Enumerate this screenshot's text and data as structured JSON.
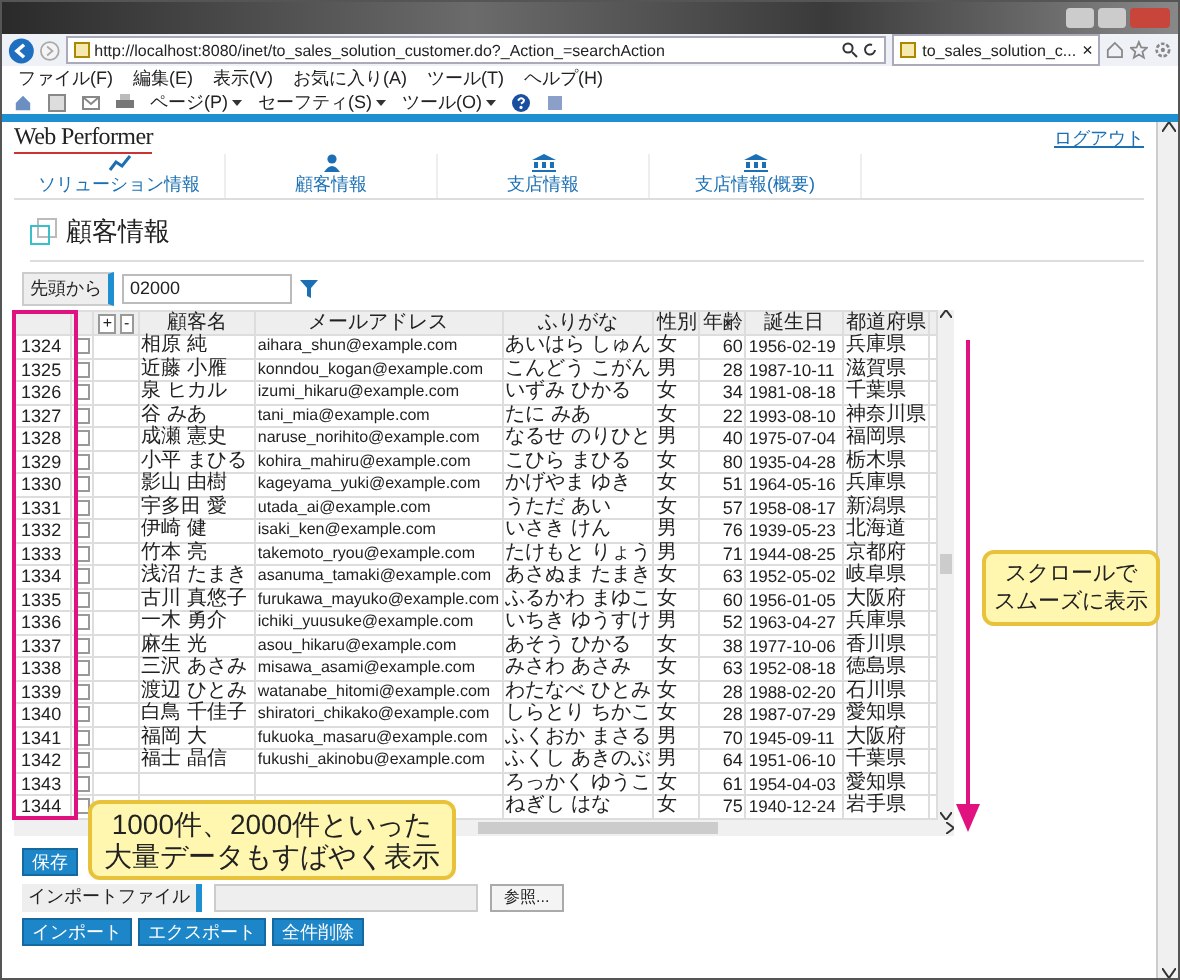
{
  "browser": {
    "address": "http://localhost:8080/inet/to_sales_solution_customer.do?_Action_=searchAction",
    "tab": {
      "title": "to_sales_solution_c...",
      "close": "×"
    },
    "menu": [
      "ファイル(F)",
      "編集(E)",
      "表示(V)",
      "お気に入り(A)",
      "ツール(T)",
      "ヘルプ(H)"
    ],
    "toolbar": [
      "ページ(P)",
      "セーフティ(S)",
      "ツール(O)"
    ]
  },
  "app": {
    "logo": "Web Performer",
    "logout": "ログアウト",
    "nav": [
      {
        "label": "ソリューション情報",
        "kind": "chart"
      },
      {
        "label": "顧客情報",
        "kind": "person"
      },
      {
        "label": "支店情報",
        "kind": "bank"
      },
      {
        "label": "支店情報(概要)",
        "kind": "bank"
      }
    ]
  },
  "page_title": "顧客情報",
  "filter": {
    "mode": "先頭から",
    "value": "02000"
  },
  "table": {
    "header_buttons": [
      "+",
      "-"
    ],
    "columns": [
      "顧客名",
      "メールアドレス",
      "ふりがな",
      "性別",
      "年齢",
      "誕生日",
      "都道府県"
    ],
    "rows": [
      {
        "no": "1324",
        "checked": false,
        "name": "相原 純",
        "email": "aihara_shun@example.com",
        "kana": "あいはら しゅん",
        "sex": "女",
        "age": "60",
        "birthday": "1956-02-19",
        "prefecture": "兵庫県"
      },
      {
        "no": "1325",
        "checked": false,
        "name": "近藤 小雁",
        "email": "konndou_kogan@example.com",
        "kana": "こんどう こがん",
        "sex": "男",
        "age": "28",
        "birthday": "1987-10-11",
        "prefecture": "滋賀県"
      },
      {
        "no": "1326",
        "checked": false,
        "name": "泉 ヒカル",
        "email": "izumi_hikaru@example.com",
        "kana": "いずみ ひかる",
        "sex": "女",
        "age": "34",
        "birthday": "1981-08-18",
        "prefecture": "千葉県"
      },
      {
        "no": "1327",
        "checked": false,
        "name": "谷 みあ",
        "email": "tani_mia@example.com",
        "kana": "たに みあ",
        "sex": "女",
        "age": "22",
        "birthday": "1993-08-10",
        "prefecture": "神奈川県"
      },
      {
        "no": "1328",
        "checked": false,
        "name": "成瀬 憲史",
        "email": "naruse_norihito@example.com",
        "kana": "なるせ のりひと",
        "sex": "男",
        "age": "40",
        "birthday": "1975-07-04",
        "prefecture": "福岡県"
      },
      {
        "no": "1329",
        "checked": false,
        "name": "小平 まひる",
        "email": "kohira_mahiru@example.com",
        "kana": "こひら まひる",
        "sex": "女",
        "age": "80",
        "birthday": "1935-04-28",
        "prefecture": "栃木県"
      },
      {
        "no": "1330",
        "checked": false,
        "name": "影山 由樹",
        "email": "kageyama_yuki@example.com",
        "kana": "かげやま ゆき",
        "sex": "女",
        "age": "51",
        "birthday": "1964-05-16",
        "prefecture": "兵庫県"
      },
      {
        "no": "1331",
        "checked": false,
        "name": "宇多田 愛",
        "email": "utada_ai@example.com",
        "kana": "うただ あい",
        "sex": "女",
        "age": "57",
        "birthday": "1958-08-17",
        "prefecture": "新潟県"
      },
      {
        "no": "1332",
        "checked": false,
        "name": "伊崎 健",
        "email": "isaki_ken@example.com",
        "kana": "いさき けん",
        "sex": "男",
        "age": "76",
        "birthday": "1939-05-23",
        "prefecture": "北海道"
      },
      {
        "no": "1333",
        "checked": false,
        "name": "竹本 亮",
        "email": "takemoto_ryou@example.com",
        "kana": "たけもと りょう",
        "sex": "男",
        "age": "71",
        "birthday": "1944-08-25",
        "prefecture": "京都府"
      },
      {
        "no": "1334",
        "checked": false,
        "name": "浅沼 たまき",
        "email": "asanuma_tamaki@example.com",
        "kana": "あさぬま たまき",
        "sex": "女",
        "age": "63",
        "birthday": "1952-05-02",
        "prefecture": "岐阜県"
      },
      {
        "no": "1335",
        "checked": false,
        "name": "古川 真悠子",
        "email": "furukawa_mayuko@example.com",
        "kana": "ふるかわ まゆこ",
        "sex": "女",
        "age": "60",
        "birthday": "1956-01-05",
        "prefecture": "大阪府"
      },
      {
        "no": "1336",
        "checked": false,
        "name": "一木 勇介",
        "email": "ichiki_yuusuke@example.com",
        "kana": "いちき ゆうすけ",
        "sex": "男",
        "age": "52",
        "birthday": "1963-04-27",
        "prefecture": "兵庫県"
      },
      {
        "no": "1337",
        "checked": false,
        "name": "麻生 光",
        "email": "asou_hikaru@example.com",
        "kana": "あそう ひかる",
        "sex": "女",
        "age": "38",
        "birthday": "1977-10-06",
        "prefecture": "香川県"
      },
      {
        "no": "1338",
        "checked": false,
        "name": "三沢 あさみ",
        "email": "misawa_asami@example.com",
        "kana": "みさわ あさみ",
        "sex": "女",
        "age": "63",
        "birthday": "1952-08-18",
        "prefecture": "徳島県"
      },
      {
        "no": "1339",
        "checked": false,
        "name": "渡辺 ひとみ",
        "email": "watanabe_hitomi@example.com",
        "kana": "わたなべ ひとみ",
        "sex": "女",
        "age": "28",
        "birthday": "1988-02-20",
        "prefecture": "石川県"
      },
      {
        "no": "1340",
        "checked": false,
        "name": "白鳥 千佳子",
        "email": "shiratori_chikako@example.com",
        "kana": "しらとり ちかこ",
        "sex": "女",
        "age": "28",
        "birthday": "1987-07-29",
        "prefecture": "愛知県"
      },
      {
        "no": "1341",
        "checked": false,
        "name": "福岡 大",
        "email": "fukuoka_masaru@example.com",
        "kana": "ふくおか まさる",
        "sex": "男",
        "age": "70",
        "birthday": "1945-09-11",
        "prefecture": "大阪府"
      },
      {
        "no": "1342",
        "checked": false,
        "name": "福士 晶信",
        "email": "fukushi_akinobu@example.com",
        "kana": "ふくし あきのぶ",
        "sex": "男",
        "age": "64",
        "birthday": "1951-06-10",
        "prefecture": "千葉県"
      },
      {
        "no": "1343",
        "checked": false,
        "kana": "ろっかく ゆうこ",
        "sex": "女",
        "age": "61",
        "birthday": "1954-04-03",
        "prefecture": "愛知県"
      },
      {
        "no": "1344",
        "checked": false,
        "kana": "ねぎし はな",
        "sex": "女",
        "age": "75",
        "birthday": "1940-12-24",
        "prefecture": "岩手県"
      }
    ]
  },
  "save_button": "保存",
  "import": {
    "label": "インポートファイル",
    "browse": "参照..."
  },
  "actions": [
    "インポート",
    "エクスポート",
    "全件削除"
  ],
  "callouts": [
    {
      "lines": [
        "1000件、2000件といった",
        "大量データもすばやく表示"
      ]
    },
    {
      "lines": [
        "スクロールで",
        "スムーズに表示"
      ]
    }
  ]
}
